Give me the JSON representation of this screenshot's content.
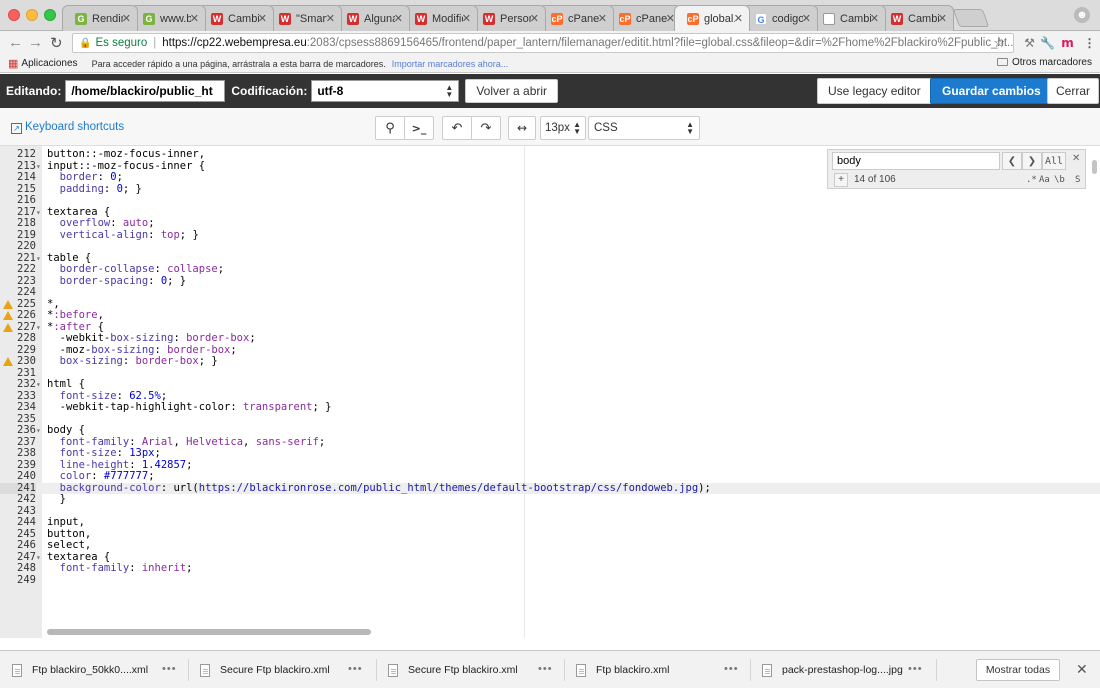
{
  "browser": {
    "tabs": [
      {
        "label": "Rendimi",
        "favicon": "G",
        "favicon_class": "green"
      },
      {
        "label": "www.bla",
        "favicon": "G",
        "favicon_class": "green"
      },
      {
        "label": "Cambio",
        "favicon": "W",
        "favicon_class": "red"
      },
      {
        "label": "\"Smart",
        "favicon": "W",
        "favicon_class": "red"
      },
      {
        "label": "Algunas",
        "favicon": "W",
        "favicon_class": "red"
      },
      {
        "label": "Modific",
        "favicon": "W",
        "favicon_class": "red"
      },
      {
        "label": "Persona",
        "favicon": "W",
        "favicon_class": "red"
      },
      {
        "label": "cPanel",
        "favicon": "cP",
        "favicon_class": "orange"
      },
      {
        "label": "cPanel",
        "favicon": "cP",
        "favicon_class": "orange"
      },
      {
        "label": "global.c",
        "favicon": "cP",
        "favicon_class": "orange",
        "active": true
      },
      {
        "label": "codigos",
        "favicon": "G",
        "favicon_class": "g"
      },
      {
        "label": "Cambia",
        "favicon": "",
        "favicon_class": "doc"
      },
      {
        "label": "Cambia",
        "favicon": "W",
        "favicon_class": "red"
      }
    ],
    "secure_label": "Es seguro",
    "url_host": "https://cp22.webempresa.eu",
    "url_rest": ":2083/cpsess8869156465/frontend/paper_lantern/filemanager/editit.html?file=global.css&fileop=&dir=%2Fhome%2Fblackiro%2Fpublic_ht...",
    "bookmarks": {
      "apps_label": "Aplicaciones",
      "hint": "Para acceder rápido a una página, arrástrala a esta barra de marcadores.",
      "import_link": "Importar marcadores ahora...",
      "other": "Otros marcadores"
    }
  },
  "editor_header": {
    "editing_label": "Editando:",
    "path": "/home/blackiro/public_ht",
    "encoding_label": "Codificación:",
    "encoding_value": "utf-8",
    "reopen_label": "Volver a abrir",
    "legacy_label": "Use legacy editor",
    "save_label": "Guardar cambios",
    "close_label": "Cerrar"
  },
  "editor_toolbar": {
    "keyboard_shortcuts": "Keyboard shortcuts",
    "font_size": "13px",
    "mode": "CSS",
    "goto_glyph": ">_"
  },
  "search": {
    "query": "body",
    "all_label": "All",
    "count": "14 of 106",
    "opt_regex": ".*",
    "opt_case": "Aa",
    "opt_word": "\\b",
    "opt_sel": "S"
  },
  "code_lines": [
    {
      "n": "212",
      "html": "button::-moz-focus-inner,"
    },
    {
      "n": "213",
      "fold": true,
      "html": "input::-moz-focus-inner {"
    },
    {
      "n": "214",
      "html": "  <span class='t-prop'>border</span>: <span class='t-num'>0</span>;"
    },
    {
      "n": "215",
      "html": "  <span class='t-prop'>padding</span>: <span class='t-num'>0</span>; }"
    },
    {
      "n": "216",
      "html": ""
    },
    {
      "n": "217",
      "fold": true,
      "html": "textarea {"
    },
    {
      "n": "218",
      "html": "  <span class='t-prop'>overflow</span>: <span class='t-val'>auto</span>;"
    },
    {
      "n": "219",
      "html": "  <span class='t-prop'>vertical-align</span>: <span class='t-val'>top</span>; }"
    },
    {
      "n": "220",
      "html": ""
    },
    {
      "n": "221",
      "fold": true,
      "html": "table {"
    },
    {
      "n": "222",
      "html": "  <span class='t-prop'>border-collapse</span>: <span class='t-val'>collapse</span>;"
    },
    {
      "n": "223",
      "html": "  <span class='t-prop'>border-spacing</span>: <span class='t-num'>0</span>; }"
    },
    {
      "n": "224",
      "html": ""
    },
    {
      "n": "225",
      "warn": true,
      "html": "*,"
    },
    {
      "n": "226",
      "warn": true,
      "html": "*<span class='t-val'>:before</span>,"
    },
    {
      "n": "227",
      "warn": true,
      "fold": true,
      "html": "*<span class='t-val'>:after</span> {"
    },
    {
      "n": "228",
      "html": "  -webkit-<span class='t-prop'>box-sizing</span>: <span class='t-val'>border-box</span>;"
    },
    {
      "n": "229",
      "html": "  -moz-<span class='t-prop'>box-sizing</span>: <span class='t-val'>border-box</span>;"
    },
    {
      "n": "230",
      "warn": true,
      "html": "  <span class='t-prop'>box-sizing</span>: <span class='t-val'>border-box</span>; }"
    },
    {
      "n": "231",
      "html": ""
    },
    {
      "n": "232",
      "fold": true,
      "html": "html {"
    },
    {
      "n": "233",
      "html": "  <span class='t-prop'>font-size</span>: <span class='t-num'>62.5%</span>;"
    },
    {
      "n": "234",
      "html": "  -webkit-tap-highlight-color: <span class='t-val'>transparent</span>; }"
    },
    {
      "n": "235",
      "html": ""
    },
    {
      "n": "236",
      "fold": true,
      "html": "body {"
    },
    {
      "n": "237",
      "html": "  <span class='t-prop'>font-family</span>: <span class='t-val'>Arial</span>, <span class='t-val'>Helvetica</span>, <span class='t-val'>sans-serif</span>;"
    },
    {
      "n": "238",
      "html": "  <span class='t-prop'>font-size</span>: <span class='t-num'>13px</span>;"
    },
    {
      "n": "239",
      "html": "  <span class='t-prop'>line-height</span>: <span class='t-num'>1.42857</span>;"
    },
    {
      "n": "240",
      "html": "  <span class='t-prop'>color</span>: <span class='t-num'>#777777</span>;"
    },
    {
      "n": "241",
      "warn": true,
      "hl": true,
      "html": "  <span class='t-prop'>background-color</span>: url(<span class='t-str'>https://blackironrose.com/public_html/themes/default-bootstrap/css/fondoweb.jpg</span>);"
    },
    {
      "n": "242",
      "html": "  }"
    },
    {
      "n": "243",
      "html": ""
    },
    {
      "n": "244",
      "html": "input,"
    },
    {
      "n": "245",
      "html": "button,"
    },
    {
      "n": "246",
      "html": "select,"
    },
    {
      "n": "247",
      "fold": true,
      "html": "textarea {"
    },
    {
      "n": "248",
      "html": "  <span class='t-prop'>font-family</span>: <span class='t-val'>inherit</span>;"
    },
    {
      "n": "249",
      "html": ""
    }
  ],
  "downloads": [
    {
      "name": "Ftp blackiro_50kk0....xml"
    },
    {
      "name": "Secure Ftp blackiro.xml"
    },
    {
      "name": "Secure Ftp blackiro.xml"
    },
    {
      "name": "Ftp blackiro.xml"
    },
    {
      "name": "pack-prestashop-log....jpg"
    }
  ],
  "show_all_label": "Mostrar todas"
}
